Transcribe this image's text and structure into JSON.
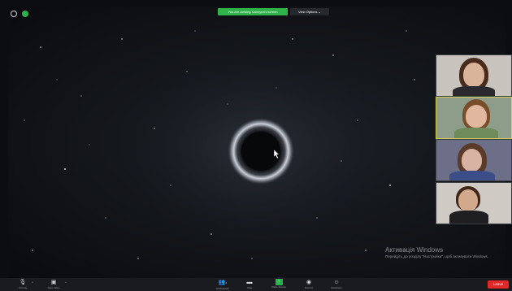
{
  "banner": {
    "sharing_text": "You are viewing Kateryna's screen",
    "view_options_label": "View Options",
    "view_options_caret": "⌄"
  },
  "top_icons": [
    "info-icon",
    "shield-icon"
  ],
  "stage": {
    "content": "black-hole-space-image",
    "background_color": "#14171c"
  },
  "participants": [
    {
      "id": "participant-1",
      "active": false,
      "skin": "#d9b49a",
      "hair": "#4a2c1c",
      "shirt": "#2a2a2e",
      "bg": "#c9c3bd"
    },
    {
      "id": "participant-2",
      "active": true,
      "skin": "#e1b89f",
      "hair": "#7a4d2a",
      "shirt": "#6f8a5b",
      "bg": "#8d9d8a"
    },
    {
      "id": "participant-3",
      "active": false,
      "skin": "#d8b2a2",
      "hair": "#5a3b2a",
      "shirt": "#3b4e8a",
      "bg": "#6d6f89"
    },
    {
      "id": "participant-4",
      "active": false,
      "skin": "#d3a98b",
      "hair": "#3e2618",
      "shirt": "#1f1f22",
      "bg": "#cfcac4"
    }
  ],
  "watermark": {
    "title": "Активація Windows",
    "text": "Перейдіть до розділу \"Настройки\", щоб активувати Windows."
  },
  "toolbar": {
    "unmute_label": "Unmute",
    "start_video_label": "Start Video",
    "participants_label": "Participants",
    "participants_count": "6",
    "chat_label": "Chat",
    "share_screen_label": "Share Screen",
    "record_label": "Record",
    "reactions_label": "Reactions",
    "leave_label": "Leave"
  },
  "colors": {
    "accent_green": "#2fb34a",
    "leave_red": "#e02828",
    "active_border": "#d2cb58"
  }
}
